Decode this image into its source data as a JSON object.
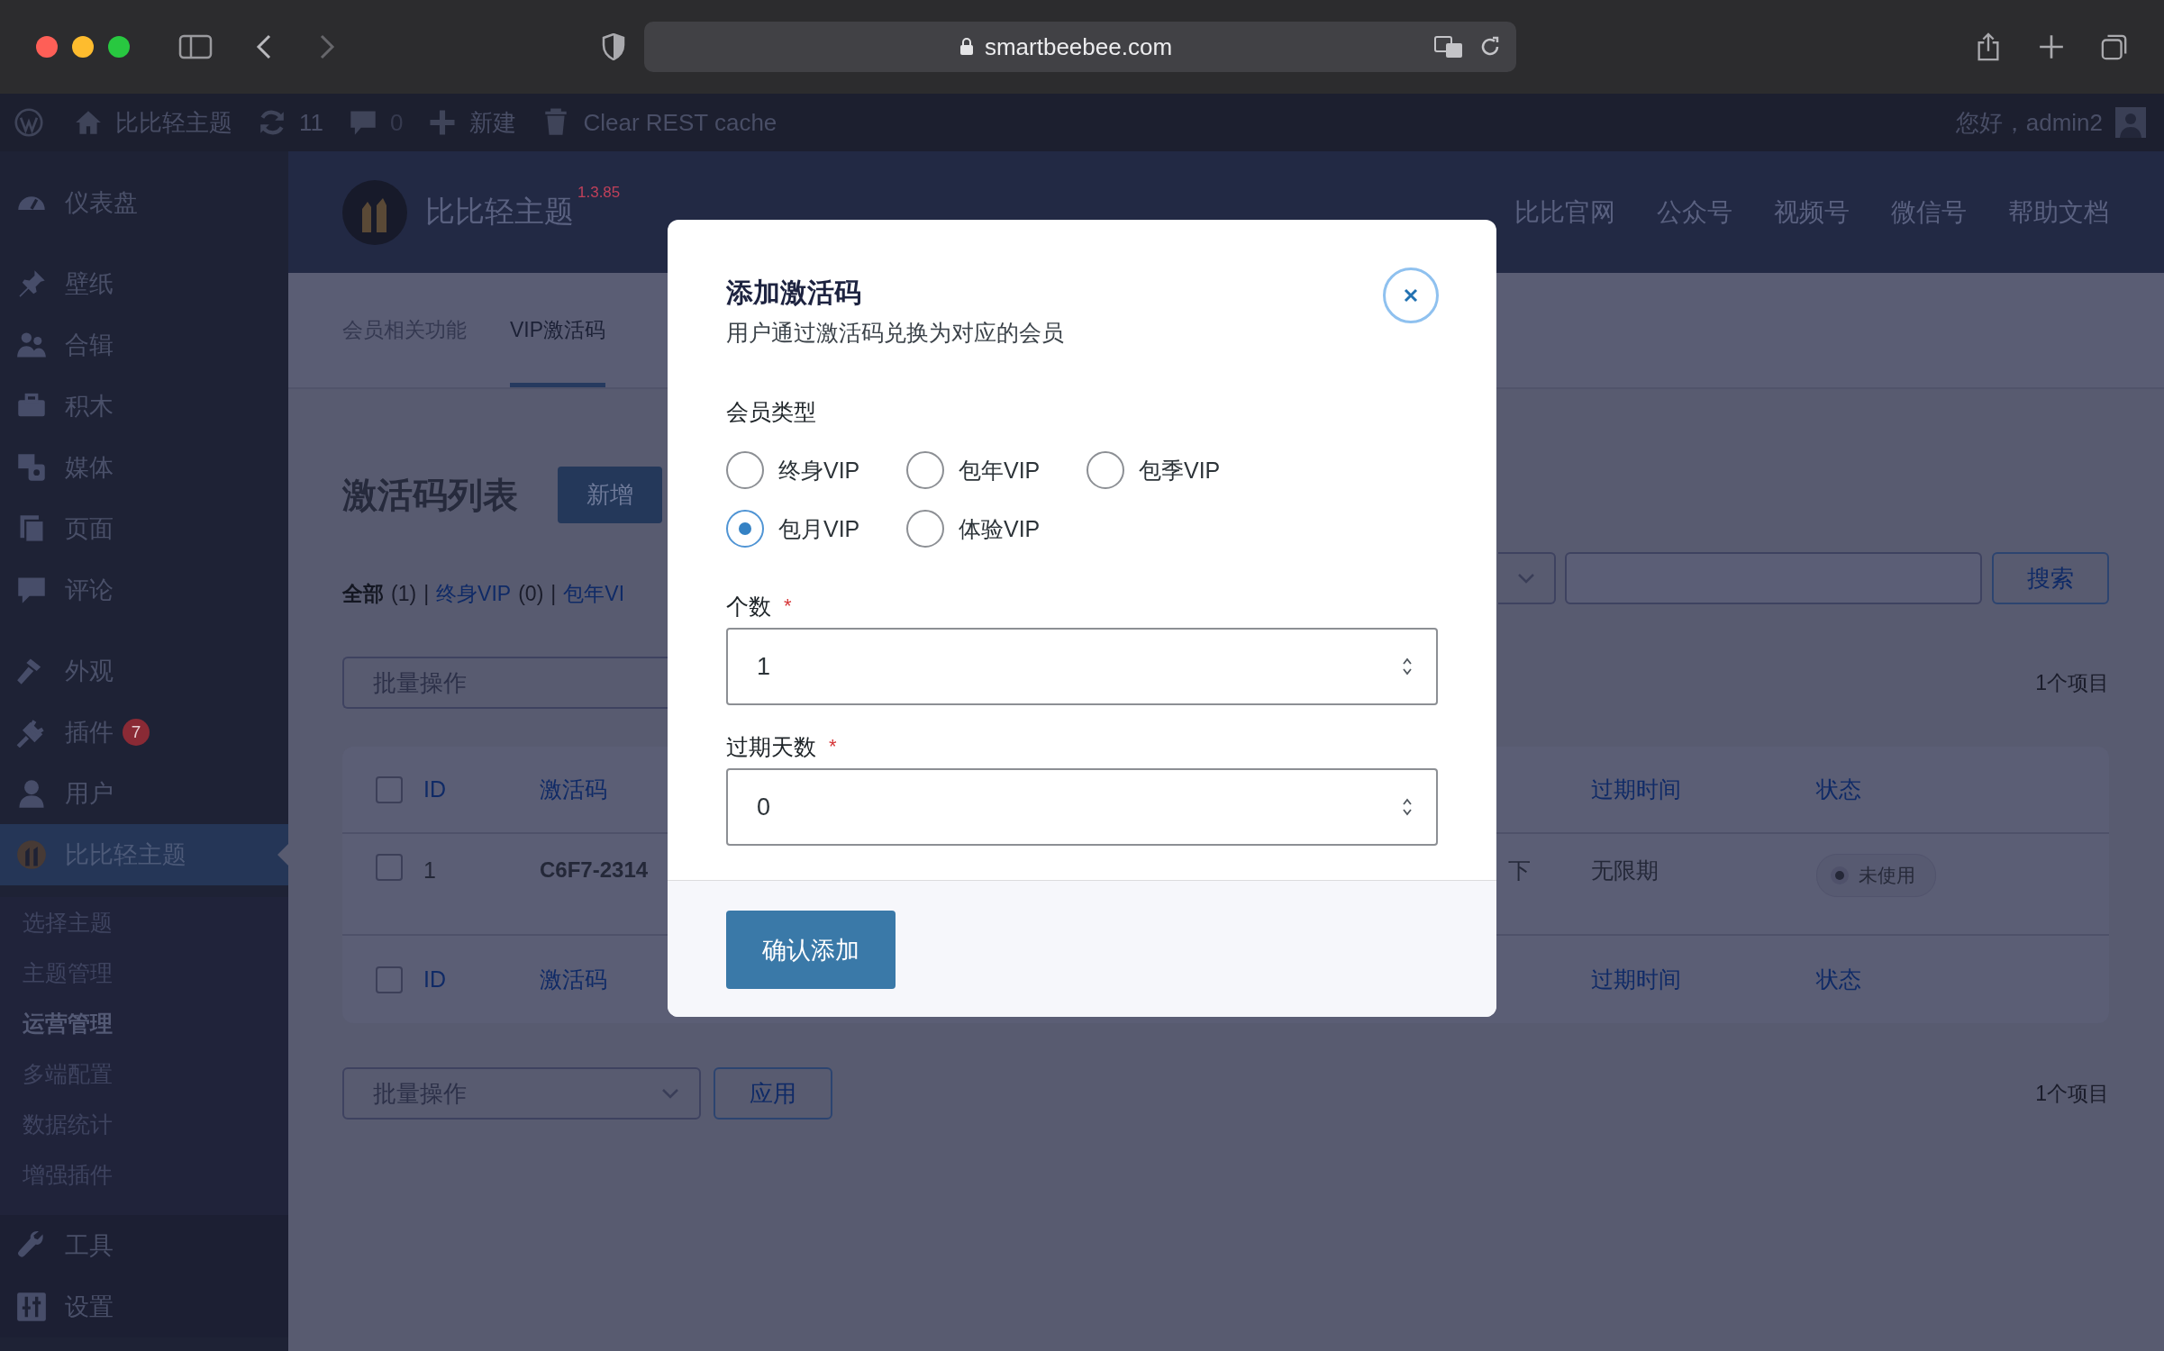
{
  "browser": {
    "url": "smartbeebee.com"
  },
  "admin_bar": {
    "site_name": "比比轻主题",
    "updates": "11",
    "comments": "0",
    "new_label": "新建",
    "clear_cache": "Clear REST cache",
    "greeting": "您好，admin2"
  },
  "sidebar": {
    "groups": [
      {
        "items": [
          {
            "label": "仪表盘",
            "selected": false
          }
        ]
      },
      {
        "items": [
          {
            "label": "壁纸",
            "selected": false
          },
          {
            "label": "合辑",
            "selected": false
          },
          {
            "label": "积木",
            "selected": false
          },
          {
            "label": "媒体",
            "selected": false
          },
          {
            "label": "页面",
            "selected": false
          },
          {
            "label": "评论",
            "selected": false
          }
        ]
      },
      {
        "items": [
          {
            "label": "外观",
            "selected": false
          },
          {
            "label": "插件",
            "selected": false,
            "badge": "7"
          },
          {
            "label": "用户",
            "selected": false
          },
          {
            "label": "比比轻主题",
            "selected": true,
            "children": [
              {
                "label": "选择主题",
                "selected": false
              },
              {
                "label": "主题管理",
                "selected": false
              },
              {
                "label": "运营管理",
                "selected": true
              },
              {
                "label": "多端配置",
                "selected": false
              },
              {
                "label": "数据统计",
                "selected": false
              },
              {
                "label": "增强插件",
                "selected": false
              }
            ]
          }
        ]
      },
      {
        "items": [
          {
            "label": "工具",
            "selected": false
          },
          {
            "label": "设置",
            "selected": false
          }
        ]
      }
    ]
  },
  "plugin": {
    "name": "比比轻主题",
    "version": "1.3.85",
    "nav": [
      "比比官网",
      "公众号",
      "视频号",
      "微信号",
      "帮助文档"
    ]
  },
  "tabs": [
    {
      "label": "会员相关功能",
      "selected": false
    },
    {
      "label": "VIP激活码",
      "selected": true
    }
  ],
  "list": {
    "title": "激活码列表",
    "add_button": "新增",
    "filters": [
      {
        "label": "全部",
        "count": "(1)",
        "selected": true
      },
      {
        "prefix": "|",
        "label": "终身VIP",
        "count": "(0)",
        "selected": false
      },
      {
        "prefix": "|",
        "label": "包年VI",
        "selected": false
      }
    ],
    "search_button": "搜索",
    "bulk_top": "批量操作",
    "count_top": "1个项目",
    "bulk_bottom": "批量操作",
    "apply_button": "应用",
    "count_bottom": "1个项目"
  },
  "table": {
    "header_checked": false,
    "columns": [
      "ID",
      "激活码",
      "过期时间",
      "状态"
    ],
    "rows": [
      {
        "checked": false,
        "id": "1",
        "code": "C6F7-2314",
        "column_4": "下",
        "expiry": "无限期",
        "status": "未使用"
      }
    ],
    "footer_checked": false,
    "footer_columns": [
      "ID",
      "激活码",
      "过期时间",
      "状态"
    ]
  },
  "modal": {
    "title": "添加激活码",
    "subtitle": "用户通过激活码兑换为对应的会员",
    "type_label": "会员类型",
    "types": [
      {
        "label": "终身VIP",
        "selected": false
      },
      {
        "label": "包年VIP",
        "selected": false
      },
      {
        "label": "包季VIP",
        "selected": false
      },
      {
        "label": "包月VIP",
        "selected": true
      },
      {
        "label": "体验VIP",
        "selected": false
      }
    ],
    "fields": [
      {
        "label": "个数",
        "required_mark": "*",
        "value": "1"
      },
      {
        "label": "过期天数",
        "required_mark": "*",
        "value": "0"
      }
    ],
    "submit": "确认添加"
  }
}
